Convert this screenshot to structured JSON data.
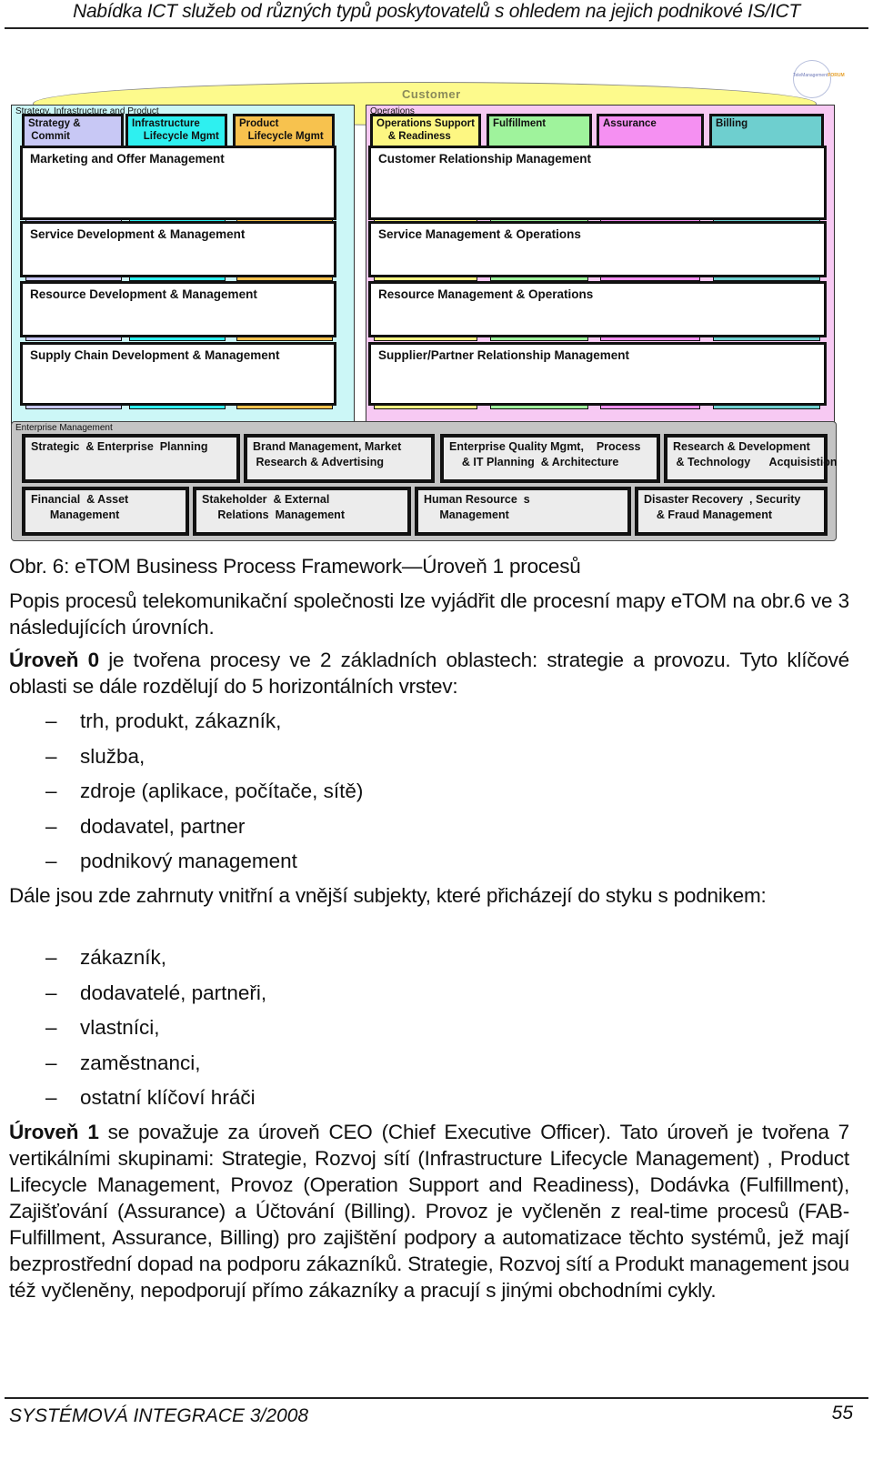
{
  "header": {
    "running_title": "Nabídka ICT služeb od různých typů poskytovatelů s ohledem na jejich podnikové IS/ICT"
  },
  "diagram": {
    "logo_text": "TeleManagement",
    "logo_text_accent": "FORUM",
    "customer_label": "Customer",
    "sip_area": {
      "label": "Strategy, Infrastructure and Product",
      "verticals": [
        {
          "label": "Strategy &\n Commit",
          "color": "#c8c8f5"
        },
        {
          "label": "Infrastructure\n    Lifecycle Mgmt",
          "color": "#2ef0f0"
        },
        {
          "label": "Product\n   Lifecycle Mgmt",
          "color": "#f7c24e"
        }
      ],
      "layers": [
        "Marketing and Offer Management",
        "Service Development & Management",
        "Resource Development & Management",
        "Supply Chain Development & Management"
      ]
    },
    "ops_area": {
      "label": "Operations",
      "verticals": [
        {
          "label": "Operations Support\n    & Readiness",
          "color": "#fdf782"
        },
        {
          "label": "Fulfillment",
          "color": "#9ff39c"
        },
        {
          "label": "Assurance",
          "color": "#f590f2"
        },
        {
          "label": "Billing",
          "color": "#6ecfcf"
        }
      ],
      "layers": [
        "Customer Relationship Management",
        "Service Management & Operations",
        "Resource Management & Operations",
        "Supplier/Partner Relationship Management"
      ]
    },
    "em_area": {
      "label": "Enterprise Management",
      "row1": [
        "Strategic  & Enterprise  Planning",
        "Brand Management, Market\n Research & Advertising",
        "Enterprise Quality Mgmt,    Process\n    & IT Planning  & Architecture",
        "Research & Development\n & Technology      Acquisistion"
      ],
      "row2": [
        "Financial  & Asset\n      Management",
        "Stakeholder  & External\n     Relations  Management",
        "Human Resource  s\n     Management",
        "Disaster Recovery  , Security\n    & Fraud Management"
      ]
    }
  },
  "content": {
    "caption": "Obr. 6: eTOM Business Process Framework—Úroveň 1 procesů",
    "p1": "Popis procesů telekomunikační společnosti lze vyjádřit dle procesní mapy eTOM na obr.6 ve 3 následujících úrovních.",
    "p2_bold": "Úroveň 0",
    "p2_rest": " je tvořena procesy ve 2 základních oblastech: strategie a provozu. Tyto klíčové oblasti se dále rozdělují do 5 horizontálních vrstev:",
    "list1": [
      "trh, produkt, zákazník,",
      "služba,",
      "zdroje (aplikace, počítače, sítě)",
      "dodavatel, partner",
      "podnikový management"
    ],
    "p3": "Dále jsou zde zahrnuty vnitřní a vnější subjekty, které přicházejí do styku s podnikem:",
    "list2": [
      "zákazník,",
      "dodavatelé, partneři,",
      "vlastníci,",
      "zaměstnanci,",
      "ostatní klíčoví hráči"
    ],
    "p4_bold": "Úroveň 1",
    "p4_rest": " se považuje za úroveň CEO (Chief Executive Officer). Tato úroveň je tvořena 7 vertikálními skupinami: Strategie, Rozvoj sítí (Infrastructure Lifecycle Management) , Product Lifecycle Management, Provoz (Operation Support and Readiness), Dodávka (Fulfillment), Zajišťování (Assurance) a Účtování (Billing). Provoz je vyčleněn z real-time procesů (FAB- Fulfillment, Assurance, Billing) pro zajištění podpory a automatizace těchto systémů, jež mají bezprostřední dopad na podporu zákazníků. Strategie, Rozvoj sítí a Produkt management jsou též vyčleněny, nepodporují přímo zákazníky a pracují s jinými obchodními cykly.",
    "list_dash": "–"
  },
  "footer": {
    "journal": "SYSTÉMOVÁ INTEGRACE 3/2008",
    "page_number": "55"
  }
}
